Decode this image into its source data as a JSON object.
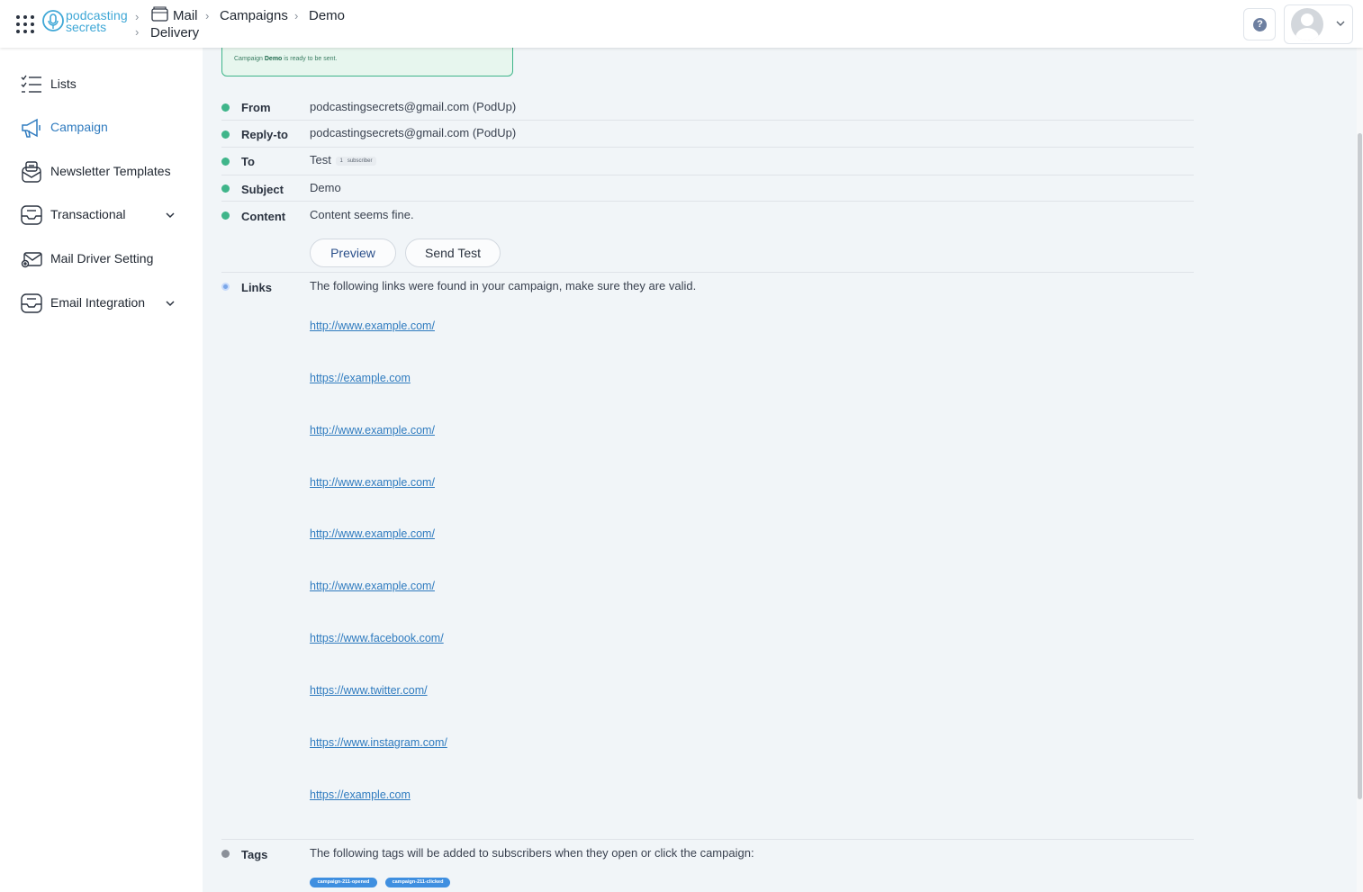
{
  "header": {
    "logo": {
      "line1": "podcasting",
      "line2": "secrets"
    },
    "breadcrumb": {
      "mail": "Mail",
      "delivery": "Delivery",
      "campaigns": "Campaigns",
      "demo": "Demo"
    },
    "help_symbol": "?"
  },
  "sidebar": {
    "items": [
      {
        "label": "Lists",
        "icon": "checklist-icon"
      },
      {
        "label": "Campaign",
        "icon": "megaphone-icon",
        "active": true
      },
      {
        "label": "Newsletter Templates",
        "icon": "newsletter-icon"
      },
      {
        "label": "Transactional",
        "icon": "inbox-icon",
        "expandable": true
      },
      {
        "label": "Mail Driver Setting",
        "icon": "mail-settings-icon"
      },
      {
        "label": "Email Integration",
        "icon": "inbox-icon",
        "expandable": true
      }
    ]
  },
  "alert": {
    "prefix": "Campaign",
    "name": "Demo",
    "suffix": "is ready to be sent."
  },
  "checks": {
    "from": {
      "key": "From",
      "value": "podcastingsecrets@gmail.com (PodUp)"
    },
    "reply_to": {
      "key": "Reply-to",
      "value": "podcastingsecrets@gmail.com (PodUp)"
    },
    "to": {
      "key": "To",
      "value": "Test",
      "count": "1",
      "count_label": "subscriber"
    },
    "subject": {
      "key": "Subject",
      "value": "Demo"
    },
    "content": {
      "key": "Content",
      "value": "Content seems fine."
    }
  },
  "buttons": {
    "preview": "Preview",
    "send_test": "Send Test"
  },
  "links_section": {
    "key": "Links",
    "description": "The following links were found in your campaign, make sure they are valid.",
    "links": [
      "http://www.example.com/",
      "https://example.com",
      "http://www.example.com/",
      "http://www.example.com/",
      "http://www.example.com/",
      "http://www.example.com/",
      "https://www.facebook.com/",
      "https://www.twitter.com/",
      "https://www.instagram.com/",
      "https://example.com"
    ]
  },
  "tags_section": {
    "key": "Tags",
    "description": "The following tags will be added to subscribers when they open or click the campaign:",
    "tags": [
      "campaign-211-opened",
      "campaign-211-clicked"
    ]
  },
  "colors": {
    "accent": "#2f7bbf",
    "success": "#3fb58a",
    "tag": "#3f8fe0"
  }
}
